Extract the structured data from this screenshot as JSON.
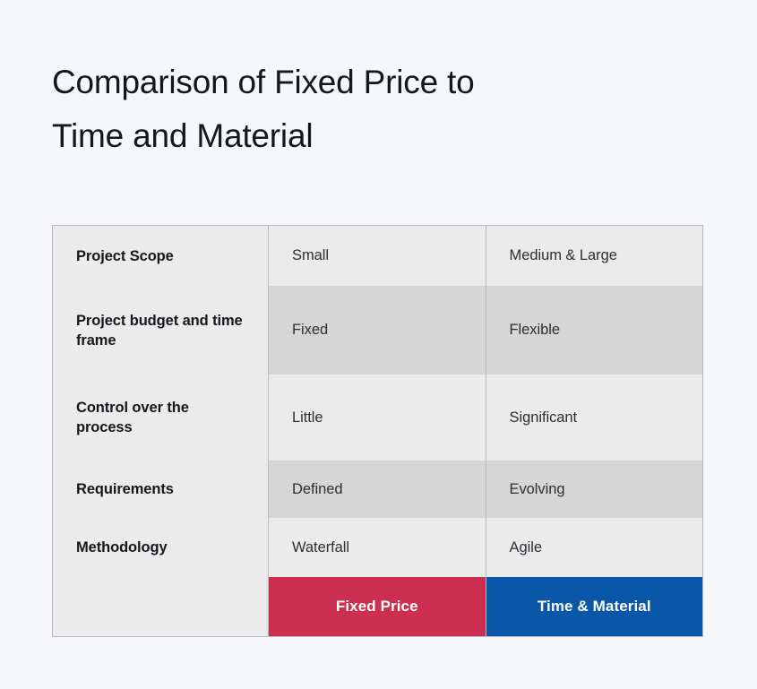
{
  "title": {
    "line1": "Comparison of Fixed Price to",
    "line2": "Time and Material"
  },
  "table": {
    "rows": [
      {
        "label": "Project Scope",
        "fixed_price": "Small",
        "time_material": "Medium & Large"
      },
      {
        "label": "Project budget and time frame",
        "fixed_price": "Fixed",
        "time_material": "Flexible"
      },
      {
        "label": "Control over the process",
        "fixed_price": "Little",
        "time_material": "Significant"
      },
      {
        "label": "Requirements",
        "fixed_price": "Defined",
        "time_material": "Evolving"
      },
      {
        "label": "Methodology",
        "fixed_price": "Waterfall",
        "time_material": "Agile"
      }
    ],
    "footer": {
      "fixed_price_label": "Fixed Price",
      "time_material_label": "Time & Material"
    }
  },
  "colors": {
    "page_background": "#F5F7FB",
    "row_light": "#EBEBEB",
    "row_dark": "#D6D6D6",
    "label_column": "#EBEBEB",
    "border": "#B9B9BC",
    "fixed_price_accent": "#CC3050",
    "time_material_accent": "#0A56A8",
    "title_text": "#14181D",
    "body_text": "#2A2F35",
    "footer_text": "#FFFFFF"
  }
}
